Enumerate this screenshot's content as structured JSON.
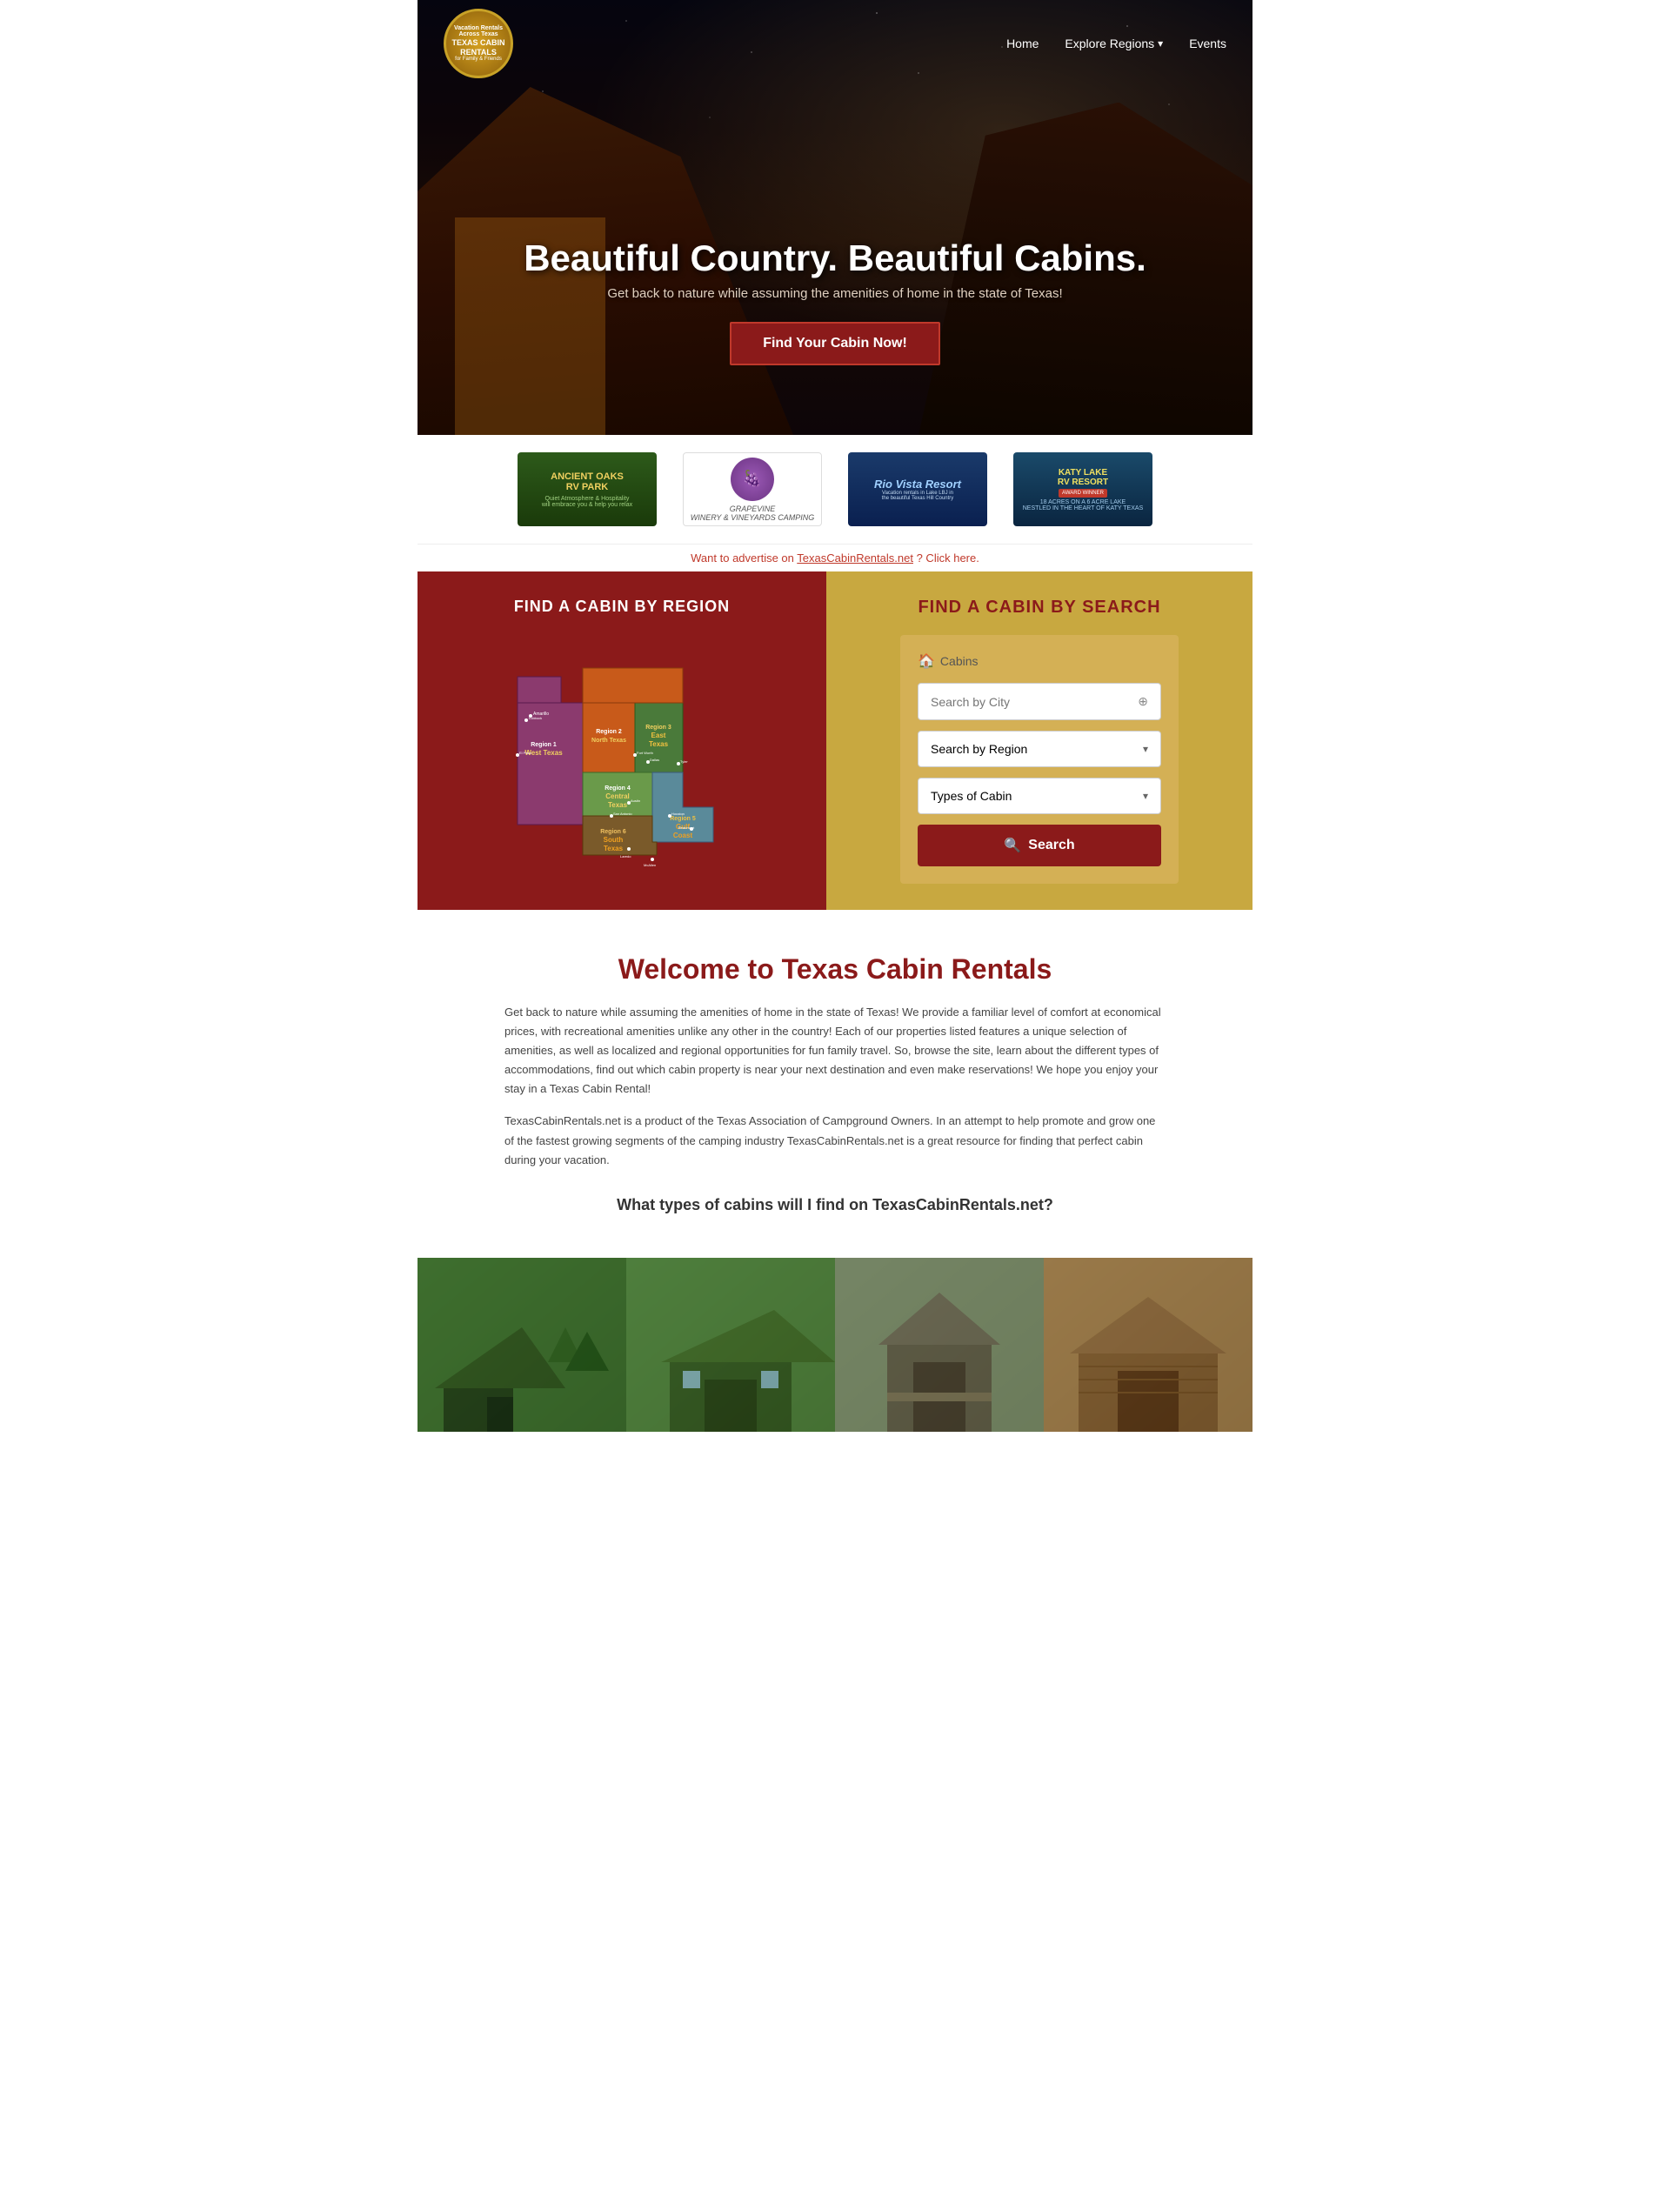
{
  "site": {
    "name": "Texas Cabin Rentals",
    "tagline": "Vacation Rentals Across Texas for Family & Friends"
  },
  "navbar": {
    "home_label": "Home",
    "explore_label": "Explore Regions",
    "events_label": "Events"
  },
  "hero": {
    "title": "Beautiful Country. Beautiful Cabins.",
    "subtitle": "Get back to nature while assuming the amenities of home in the state of Texas!",
    "cta_label": "Find Your Cabin Now!"
  },
  "sponsors": [
    {
      "id": "ancient-oaks",
      "title": "ANCIENT OAKS",
      "subtitle": "RV PARK",
      "description": "Quiet Atmosphere & Hospitality will embrace you & help you relax"
    },
    {
      "id": "grapevine",
      "title": "Grapevine",
      "subtitle": "WINERY & VINEYARDS CAMPING"
    },
    {
      "id": "rio-vista",
      "title": "Rio Vista Resort",
      "subtitle": "Vacation rentals in Lake LBJ in the beautiful Texas Hill Country"
    },
    {
      "id": "katy-lake",
      "title": "KATY LAKE RV RESORT",
      "badge": "AWARD WINNER",
      "description": "18 ACRES ON A 6 ACRE LAKE NESTLED IN THE HEART OF KATY TEXAS"
    }
  ],
  "advertise": {
    "text": "Want to advertise on TexasCabinRentals.net? Click here.",
    "link_text": "TexasCabinRentals.net"
  },
  "find_region": {
    "title": "FIND A CABIN BY REGION",
    "regions": [
      {
        "id": 1,
        "name": "Region 1",
        "subname": "West Texas"
      },
      {
        "id": 2,
        "name": "Region 2",
        "subname": "North Texas"
      },
      {
        "id": 3,
        "name": "Region 3",
        "subname": "East Texas"
      },
      {
        "id": 4,
        "name": "Region 4",
        "subname": "Central Texas"
      },
      {
        "id": 5,
        "name": "Region 5",
        "subname": "Gulf Coast"
      },
      {
        "id": 6,
        "name": "Region 6",
        "subname": "South Texas"
      }
    ]
  },
  "find_search": {
    "title": "FIND A CABIN BY SEARCH",
    "cabins_label": "Cabins",
    "search_by_city_placeholder": "Search by City",
    "search_by_region_label": "Search by Region",
    "types_of_cabin_label": "Types of Cabin",
    "search_button_label": "Search"
  },
  "welcome": {
    "title": "Welcome to Texas Cabin Rentals",
    "paragraph1": "Get back to nature while assuming the amenities of home in the state of Texas! We provide a familiar level of comfort at economical prices, with recreational amenities unlike any other in the country! Each of our properties listed features a unique selection of amenities, as well as localized and regional opportunities for fun family travel. So, browse the site, learn about the different types of accommodations, find out which cabin property is near your next destination and even make reservations! We hope you enjoy your stay in a Texas Cabin Rental!",
    "paragraph2": "TexasCabinRentals.net is a product of the Texas Association of Campground Owners. In an attempt to help promote and grow one of the fastest growing segments of the camping industry TexasCabinRentals.net is a great resource for finding that perfect cabin during your vacation.",
    "cabin_types_question": "What types of cabins will I find on TexasCabinRentals.net?"
  }
}
